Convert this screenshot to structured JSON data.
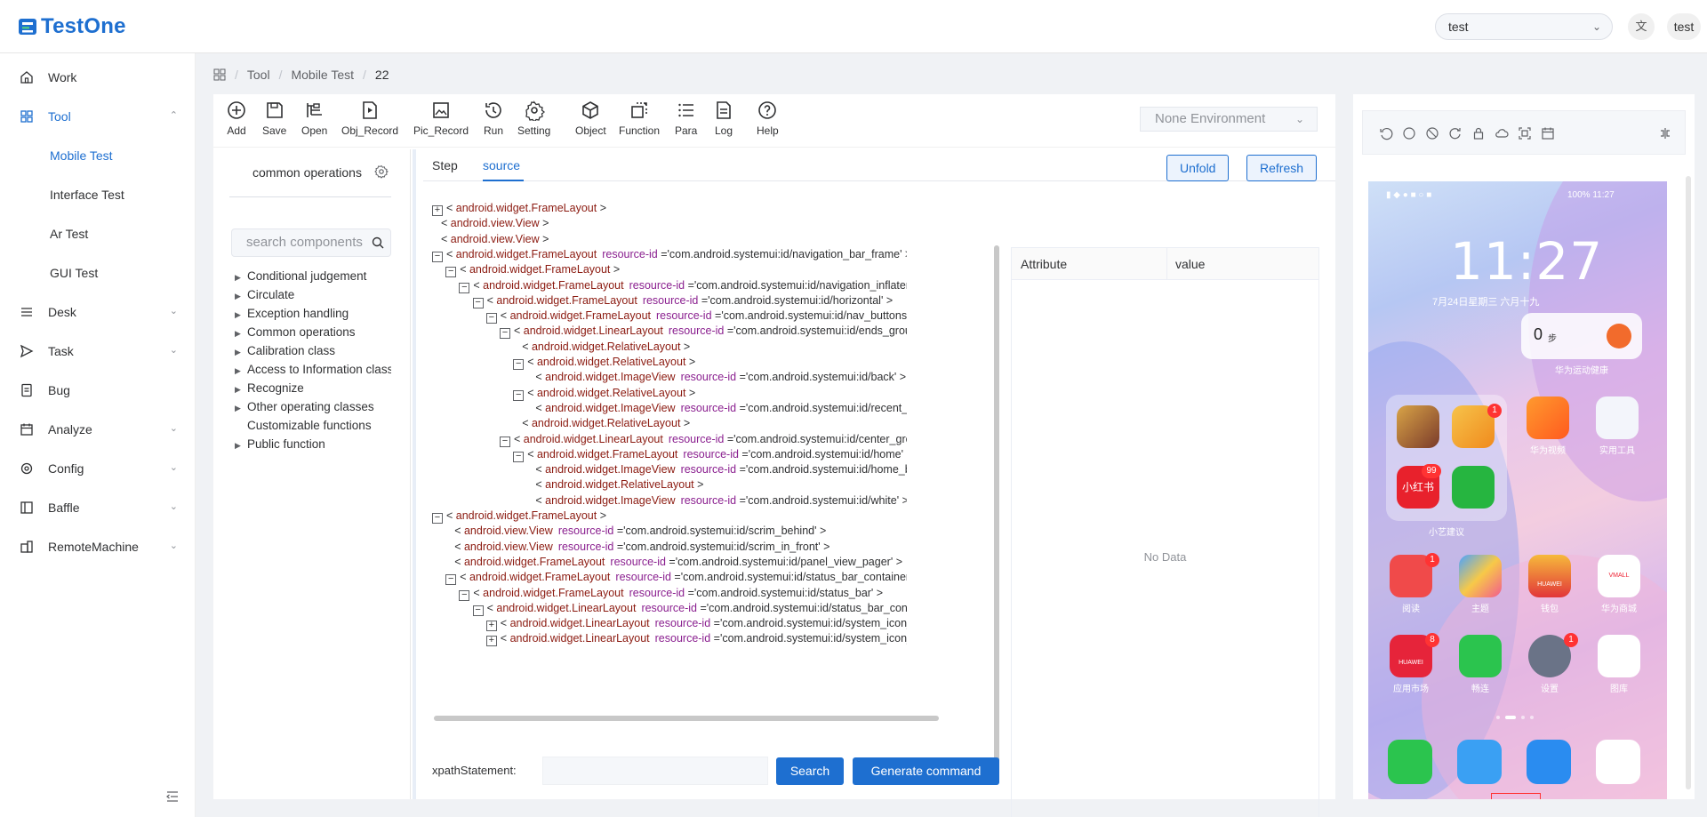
{
  "app": {
    "name": "TestOne"
  },
  "header": {
    "project_select": "test",
    "lang_icon": "translate-icon",
    "user": "test"
  },
  "sidebar": {
    "items": [
      {
        "label": "Work",
        "icon": "home-icon"
      },
      {
        "label": "Tool",
        "icon": "grid-icon",
        "expanded": true,
        "children": [
          {
            "label": "Mobile Test",
            "active": true
          },
          {
            "label": "Interface Test"
          },
          {
            "label": "Ar Test"
          },
          {
            "label": "GUI Test"
          }
        ]
      },
      {
        "label": "Desk",
        "icon": "list-icon"
      },
      {
        "label": "Task",
        "icon": "send-icon"
      },
      {
        "label": "Bug",
        "icon": "document-icon"
      },
      {
        "label": "Analyze",
        "icon": "calendar-icon"
      },
      {
        "label": "Config",
        "icon": "gear-icon"
      },
      {
        "label": "Baffle",
        "icon": "panel-icon"
      },
      {
        "label": "RemoteMachine",
        "icon": "machine-icon"
      }
    ]
  },
  "breadcrumb": {
    "items": [
      "Tool",
      "Mobile Test",
      "22"
    ]
  },
  "toolbar": {
    "tools": [
      "Add",
      "Save",
      "Open",
      "Obj_Record",
      "Pic_Record",
      "Run",
      "Setting",
      "Object",
      "Function",
      "Para",
      "Log",
      "Help"
    ],
    "environment": "None Environment"
  },
  "components": {
    "title": "common operations",
    "search_placeholder": "search components",
    "tree": [
      {
        "label": "Conditional judgement",
        "has_children": true
      },
      {
        "label": "Circulate",
        "has_children": true
      },
      {
        "label": "Exception handling",
        "has_children": true
      },
      {
        "label": "Common operations",
        "has_children": true
      },
      {
        "label": "Calibration class",
        "has_children": true
      },
      {
        "label": "Access to Information class",
        "has_children": true
      },
      {
        "label": "Recognize",
        "has_children": true
      },
      {
        "label": "Other operating classes",
        "has_children": true
      },
      {
        "label": "Customizable functions",
        "has_children": false
      },
      {
        "label": "Public function",
        "has_children": true
      }
    ]
  },
  "source": {
    "tabs": [
      "Step",
      "source"
    ],
    "active_tab": "source",
    "unfold_label": "Unfold",
    "refresh_label": "Refresh",
    "xml_lines": [
      {
        "depth": 0,
        "toggle": "+",
        "tag": "android.widget.FrameLayout",
        "rid": ""
      },
      {
        "depth": 0,
        "toggle": "",
        "tag": "android.view.View",
        "rid": ""
      },
      {
        "depth": 0,
        "toggle": "",
        "tag": "android.view.View",
        "rid": ""
      },
      {
        "depth": 0,
        "toggle": "-",
        "tag": "android.widget.FrameLayout",
        "rid": "'com.android.systemui:id/navigation_bar_frame'"
      },
      {
        "depth": 1,
        "toggle": "-",
        "tag": "android.widget.FrameLayout",
        "rid": ""
      },
      {
        "depth": 2,
        "toggle": "-",
        "tag": "android.widget.FrameLayout",
        "rid": "'com.android.systemui:id/navigation_inflater'"
      },
      {
        "depth": 3,
        "toggle": "-",
        "tag": "android.widget.FrameLayout",
        "rid": "'com.android.systemui:id/horizontal'"
      },
      {
        "depth": 4,
        "toggle": "-",
        "tag": "android.widget.FrameLayout",
        "rid": "'com.android.systemui:id/nav_buttons'"
      },
      {
        "depth": 5,
        "toggle": "-",
        "tag": "android.widget.LinearLayout",
        "rid": "'com.android.systemui:id/ends_group'"
      },
      {
        "depth": 6,
        "toggle": "",
        "tag": "android.widget.RelativeLayout",
        "rid": ""
      },
      {
        "depth": 6,
        "toggle": "-",
        "tag": "android.widget.RelativeLayout",
        "rid": ""
      },
      {
        "depth": 7,
        "toggle": "",
        "tag": "android.widget.ImageView",
        "rid": "'com.android.systemui:id/back'"
      },
      {
        "depth": 6,
        "toggle": "-",
        "tag": "android.widget.RelativeLayout",
        "rid": ""
      },
      {
        "depth": 7,
        "toggle": "",
        "tag": "android.widget.ImageView",
        "rid": "'com.android.systemui:id/recent_apps'"
      },
      {
        "depth": 6,
        "toggle": "",
        "tag": "android.widget.RelativeLayout",
        "rid": ""
      },
      {
        "depth": 5,
        "toggle": "-",
        "tag": "android.widget.LinearLayout",
        "rid": "'com.android.systemui:id/center_group'"
      },
      {
        "depth": 6,
        "toggle": "-",
        "tag": "android.widget.FrameLayout",
        "rid": "'com.android.systemui:id/home'"
      },
      {
        "depth": 7,
        "toggle": "",
        "tag": "android.widget.ImageView",
        "rid": "'com.android.systemui:id/home_button'"
      },
      {
        "depth": 7,
        "toggle": "",
        "tag": "android.widget.RelativeLayout",
        "rid": ""
      },
      {
        "depth": 7,
        "toggle": "",
        "tag": "android.widget.ImageView",
        "rid": "'com.android.systemui:id/white'"
      },
      {
        "depth": 0,
        "toggle": "-",
        "tag": "android.widget.FrameLayout",
        "rid": ""
      },
      {
        "depth": 1,
        "toggle": "",
        "tag": "android.view.View",
        "rid": "'com.android.systemui:id/scrim_behind'"
      },
      {
        "depth": 1,
        "toggle": "",
        "tag": "android.view.View",
        "rid": "'com.android.systemui:id/scrim_in_front'"
      },
      {
        "depth": 1,
        "toggle": "",
        "tag": "android.widget.FrameLayout",
        "rid": "'com.android.systemui:id/panel_view_pager'"
      },
      {
        "depth": 1,
        "toggle": "-",
        "tag": "android.widget.FrameLayout",
        "rid": "'com.android.systemui:id/status_bar_container'"
      },
      {
        "depth": 2,
        "toggle": "-",
        "tag": "android.widget.FrameLayout",
        "rid": "'com.android.systemui:id/status_bar'"
      },
      {
        "depth": 3,
        "toggle": "-",
        "tag": "android.widget.LinearLayout",
        "rid": "'com.android.systemui:id/status_bar_contents'"
      },
      {
        "depth": 4,
        "toggle": "+",
        "tag": "android.widget.LinearLayout",
        "rid": "'com.android.systemui:id/system_icon_area'"
      },
      {
        "depth": 4,
        "toggle": "+",
        "tag": "android.widget.LinearLayout",
        "rid": "'com.android.systemui:id/system_icon_unsafe'"
      }
    ],
    "attr_label": "resource-id",
    "attribute_header": "Attribute",
    "value_header": "value",
    "no_data": "No Data",
    "xpath_label": "xpathStatement:",
    "xpath_value": "",
    "search_label": "Search",
    "generate_label": "Generate command"
  },
  "phone": {
    "status_right": "100% 11:27",
    "time": "11:27",
    "date": "7月24日星期三 六月十九",
    "steps": "0",
    "steps_unit": "步",
    "health_label": "华为运动健康",
    "folder_label": "小艺建议",
    "apps": [
      {
        "label": "华为视频",
        "badge": ""
      },
      {
        "label": "实用工具",
        "badge": ""
      },
      {
        "label": "阅读",
        "badge": "1"
      },
      {
        "label": "主题",
        "badge": ""
      },
      {
        "label": "钱包",
        "badge": ""
      },
      {
        "label": "华为商城",
        "badge": ""
      },
      {
        "label": "应用市场",
        "badge": "8"
      },
      {
        "label": "畅连",
        "badge": ""
      },
      {
        "label": "设置",
        "badge": "1"
      },
      {
        "label": "图库",
        "badge": ""
      }
    ],
    "folder_badges": [
      "1",
      "99"
    ],
    "xiaohongshu": "小红书",
    "vmall": "VMALL",
    "huawei": "HUAWEI"
  }
}
